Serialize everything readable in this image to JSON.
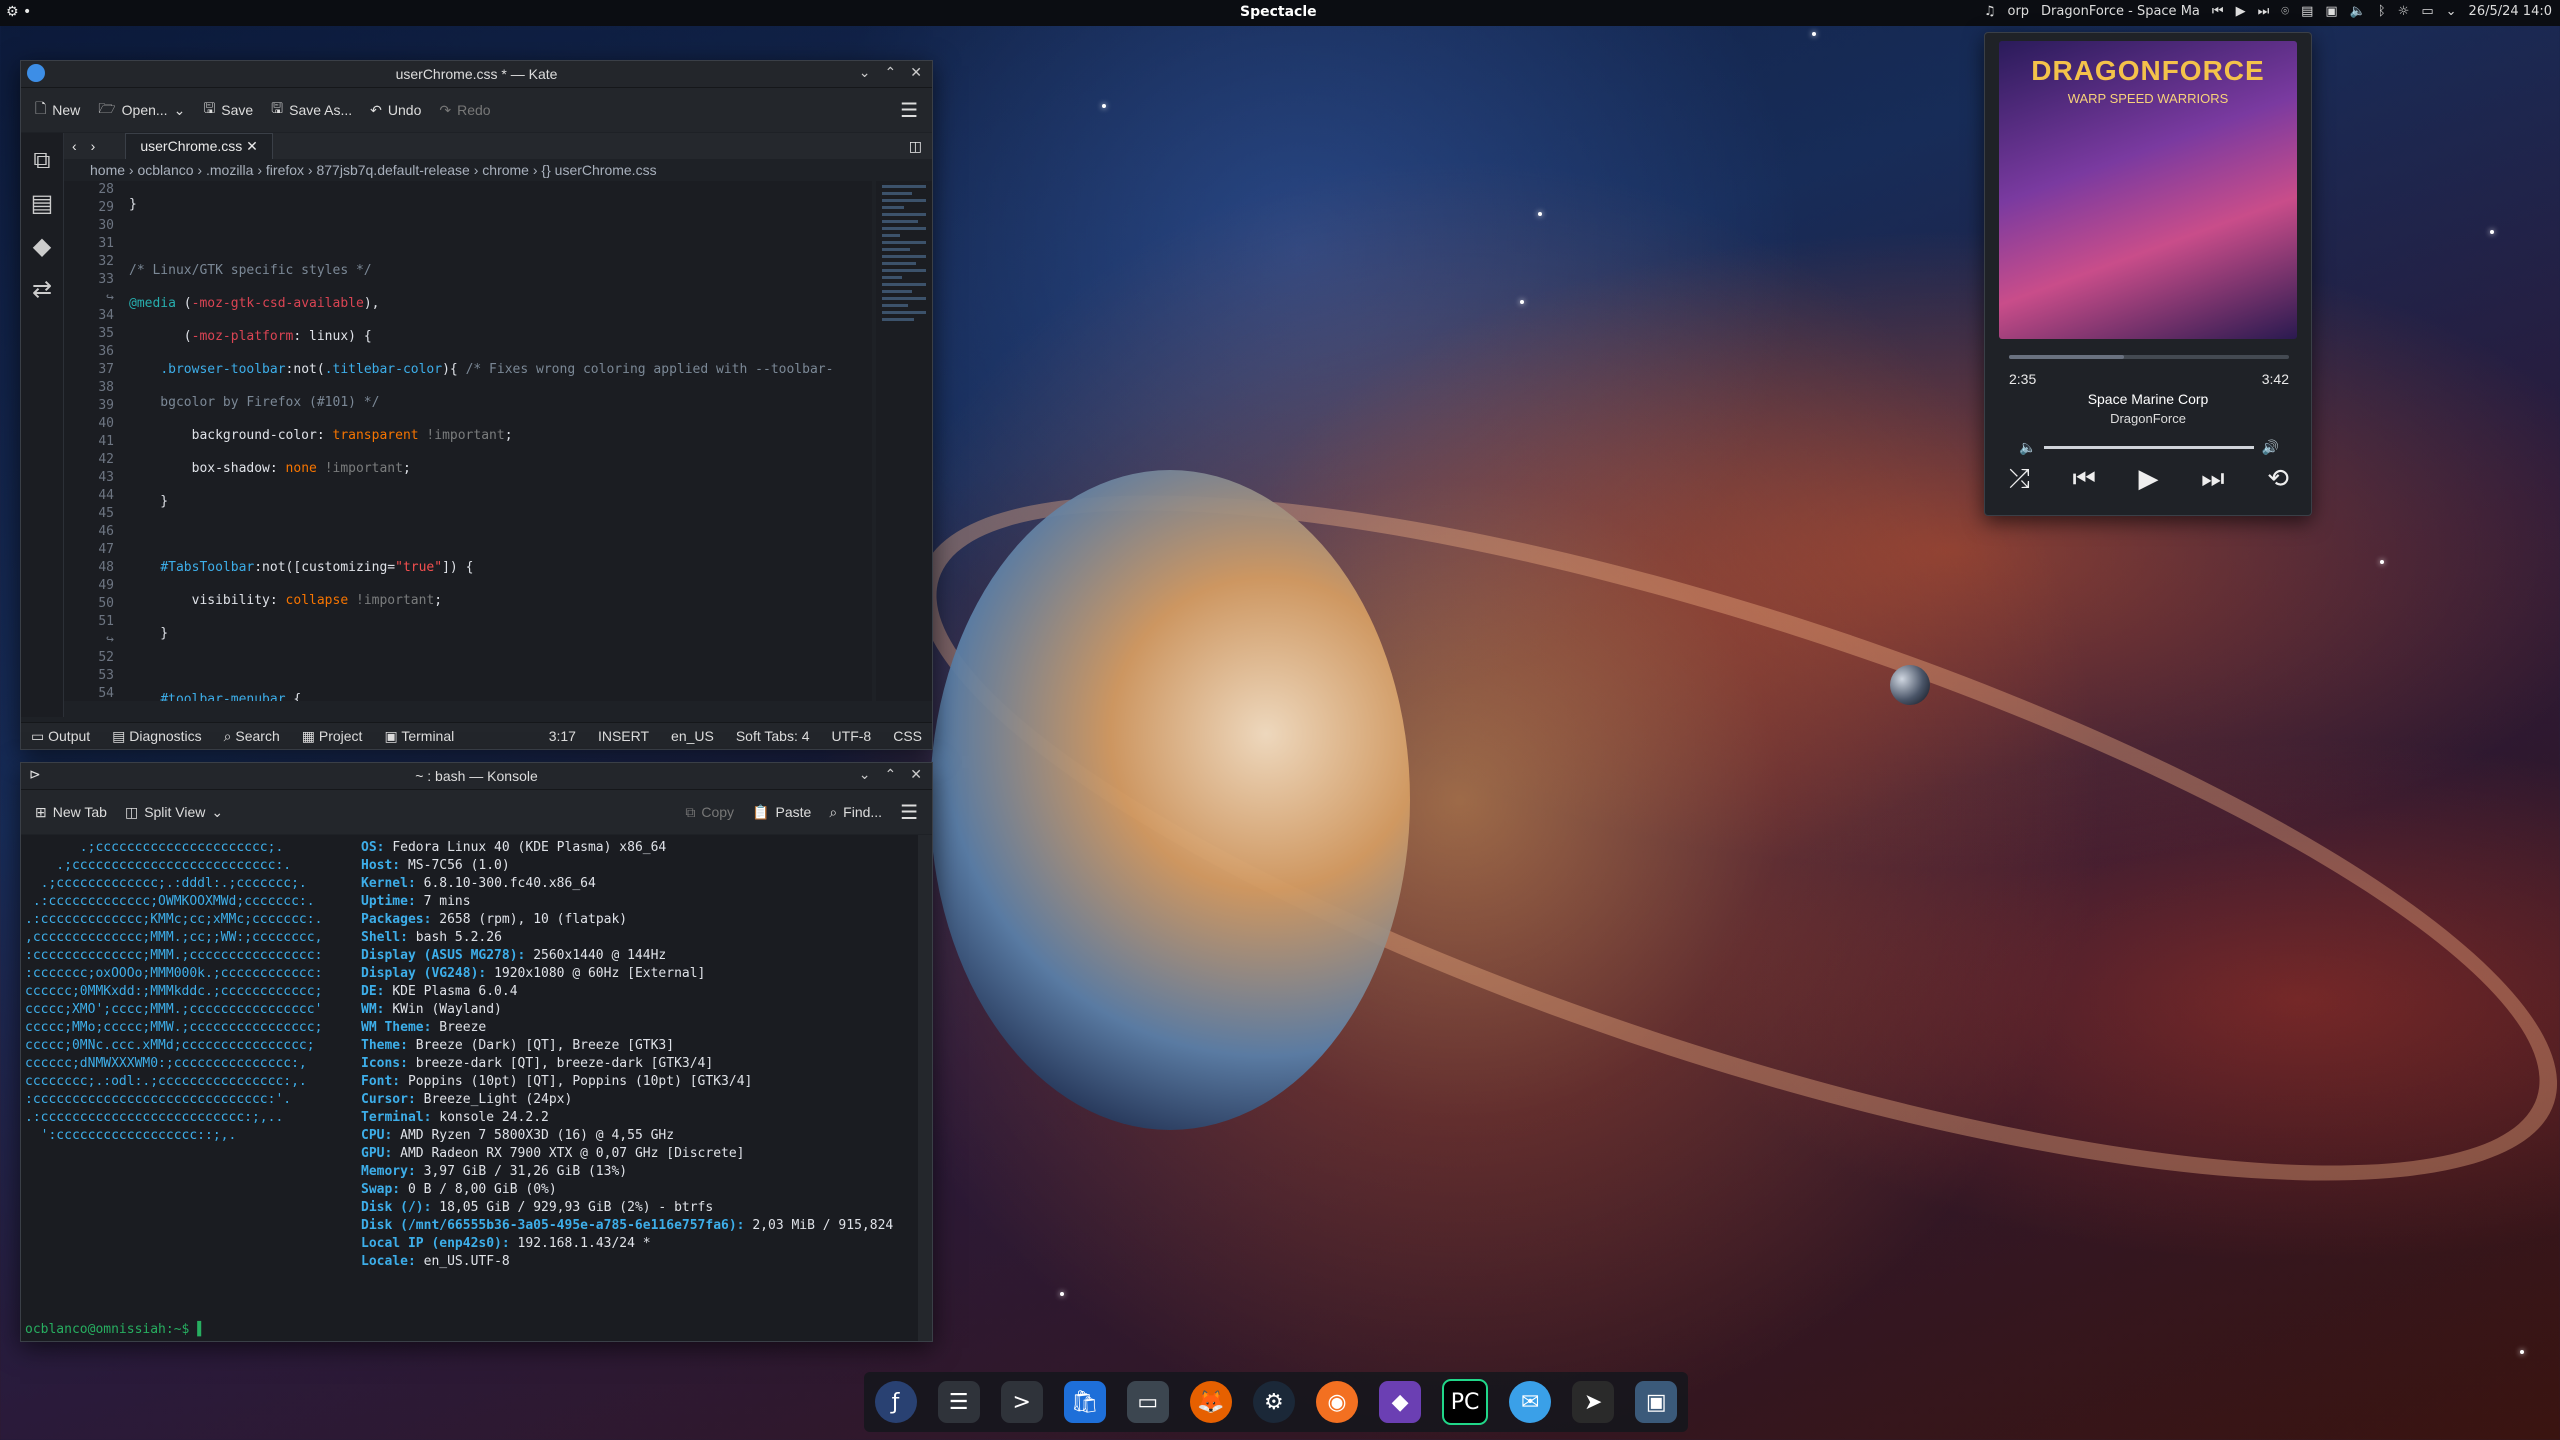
{
  "top_panel": {
    "app_name": "Spectacle",
    "now_playing": "DragonForce - Space Ma",
    "now_playing_prefix": "orp",
    "datetime": "26/5/24 14:0"
  },
  "kate": {
    "title": "userChrome.css * — Kate",
    "toolbar": {
      "new": "New",
      "open": "Open...",
      "save": "Save",
      "save_as": "Save As...",
      "undo": "Undo",
      "redo": "Redo"
    },
    "tab": "userChrome.css",
    "breadcrumb": [
      "home",
      "ocblanco",
      ".mozilla",
      "firefox",
      "877jsb7q.default-release",
      "chrome",
      "userChrome.css"
    ],
    "line_numbers": [
      "28",
      "29",
      "30",
      "31",
      "32",
      "33",
      "",
      "34",
      "35",
      "36",
      "37",
      "38",
      "39",
      "40",
      "41",
      "42",
      "43",
      "44",
      "45",
      "46",
      "47",
      "48",
      "49",
      "50",
      "51",
      "",
      "52",
      "53",
      "54"
    ],
    "status": {
      "output": "Output",
      "diagnostics": "Diagnostics",
      "search": "Search",
      "project": "Project",
      "terminal": "Terminal",
      "cursor": "3:17",
      "mode": "INSERT",
      "locale": "en_US",
      "tabs": "Soft Tabs: 4",
      "encoding": "UTF-8",
      "syntax": "CSS"
    }
  },
  "konsole": {
    "title": "~ : bash — Konsole",
    "toolbar": {
      "new_tab": "New Tab",
      "split_view": "Split View",
      "copy": "Copy",
      "paste": "Paste",
      "find": "Find..."
    },
    "logo": [
      "       .;cccccccccccccccccccccc;.",
      "    .;cccccccccccccccccccccccccc:.",
      "  .;ccccccccccccc;.:dddl:.;ccccccc;.",
      " .:ccccccccccccc;OWMKOOXMWd;ccccccc:.",
      ".:ccccccccccccc;KMMc;cc;xMMc;ccccccc:.",
      ",cccccccccccccc;MMM.;cc;;WW:;cccccccc,",
      ":cccccccccccccc;MMM.;cccccccccccccccc:",
      ":ccccccc;oxOOOo;MMM000k.;cccccccccccc:",
      "cccccc;0MMKxdd:;MMMkddc.;cccccccccccc;",
      "ccccc;XMO';cccc;MMM.;cccccccccccccccc'",
      "ccccc;MMo;ccccc;MMW.;cccccccccccccccc;",
      "ccccc;0MNc.ccc.xMMd;cccccccccccccccc;",
      "cccccc;dNMWXXXWM0:;ccccccccccccccc:,",
      "cccccccc;.:odl:.;cccccccccccccccc:,.",
      ":cccccccccccccccccccccccccccccc:'.",
      ".:cccccccccccccccccccccccccc:;,..",
      "  ':cccccccccccccccccc::;,."
    ],
    "info": [
      {
        "key": "OS",
        "value": "Fedora Linux 40 (KDE Plasma) x86_64"
      },
      {
        "key": "Host",
        "value": "MS-7C56 (1.0)"
      },
      {
        "key": "Kernel",
        "value": "6.8.10-300.fc40.x86_64"
      },
      {
        "key": "Uptime",
        "value": "7 mins"
      },
      {
        "key": "Packages",
        "value": "2658 (rpm), 10 (flatpak)"
      },
      {
        "key": "Shell",
        "value": "bash 5.2.26"
      },
      {
        "key": "Display (ASUS MG278)",
        "value": "2560x1440 @ 144Hz"
      },
      {
        "key": "Display (VG248)",
        "value": "1920x1080 @ 60Hz [External]"
      },
      {
        "key": "DE",
        "value": "KDE Plasma 6.0.4"
      },
      {
        "key": "WM",
        "value": "KWin (Wayland)"
      },
      {
        "key": "WM Theme",
        "value": "Breeze"
      },
      {
        "key": "Theme",
        "value": "Breeze (Dark) [QT], Breeze [GTK3]"
      },
      {
        "key": "Icons",
        "value": "breeze-dark [QT], breeze-dark [GTK3/4]"
      },
      {
        "key": "Font",
        "value": "Poppins (10pt) [QT], Poppins (10pt) [GTK3/4]"
      },
      {
        "key": "Cursor",
        "value": "Breeze_Light (24px)"
      },
      {
        "key": "Terminal",
        "value": "konsole 24.2.2"
      },
      {
        "key": "CPU",
        "value": "AMD Ryzen 7 5800X3D (16) @ 4,55 GHz"
      },
      {
        "key": "GPU",
        "value": "AMD Radeon RX 7900 XTX @ 0,07 GHz [Discrete]"
      },
      {
        "key": "Memory",
        "value": "3,97 GiB / 31,26 GiB (13%)"
      },
      {
        "key": "Swap",
        "value": "0 B / 8,00 GiB (0%)"
      },
      {
        "key": "Disk (/)",
        "value": "18,05 GiB / 929,93 GiB (2%) - btrfs"
      },
      {
        "key": "Disk (/mnt/66555b36-3a05-495e-a785-6e116e757fa6)",
        "value": "2,03 MiB / 915,824"
      },
      {
        "key": "Local IP (enp42s0)",
        "value": "192.168.1.43/24 *"
      },
      {
        "key": "Locale",
        "value": "en_US.UTF-8"
      }
    ],
    "swatches": [
      "#555555",
      "#cc3333",
      "#2ecc71",
      "#f39c12",
      "#3498db",
      "#9b59b6",
      "#1abc9c",
      "#ffffff"
    ],
    "prompt": "ocblanco@omnissiah:~$ "
  },
  "media": {
    "album_title": "DRAGONFORCE",
    "album_sub": "WARP SPEED WARRIORS",
    "elapsed": "2:35",
    "duration": "3:42",
    "progress": 0.41,
    "track": "Space Marine Corp",
    "artist": "DragonForce"
  }
}
